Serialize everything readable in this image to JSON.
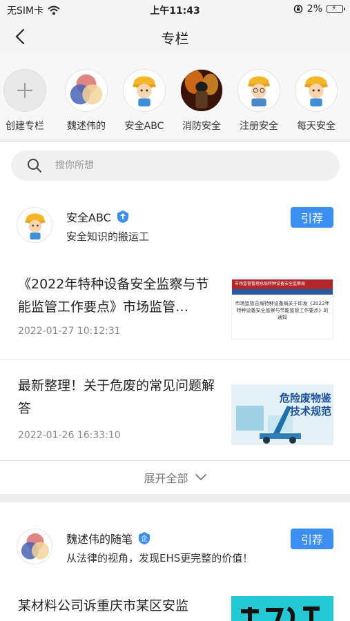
{
  "status_bar": {
    "carrier": "无SIM卡",
    "time": "上午11:43",
    "battery": "2%"
  },
  "nav": {
    "title": "专栏"
  },
  "columns": [
    {
      "label": "创建专栏",
      "icon": "plus-icon"
    },
    {
      "label": "魏述伟的",
      "icon": "venn-avatar"
    },
    {
      "label": "安全ABC",
      "icon": "worker-avatar"
    },
    {
      "label": "消防安全",
      "icon": "firefighter-avatar"
    },
    {
      "label": "注册安全",
      "icon": "worker-glasses-avatar"
    },
    {
      "label": "每天安全",
      "icon": "worker-avatar"
    }
  ],
  "search": {
    "placeholder": "搜你所想"
  },
  "feed": [
    {
      "author": "安全ABC",
      "badge": "verified-arrow",
      "desc": "安全知识的搬运工",
      "subscribe_label": "引荐",
      "articles": [
        {
          "title": "《2022年特种设备安全监察与节能监管工作要点》市场监管…",
          "date": "2022-01-27 10:12:31",
          "thumb": {
            "header": "市场监督管理总局特种设备安全监察局",
            "caption": "市场监管总局特种设备局关于印发《2022年特种设备安全监察与节能监管工作要点》的通知"
          }
        },
        {
          "title": "最新整理！关于危废的常见问题解答",
          "date": "2022-01-26 16:33:10",
          "thumb": {
            "line1": "危险废物鉴",
            "line2": "技术规范"
          }
        }
      ]
    },
    {
      "author": "魏述伟的随笔",
      "badge": "enterprise-企",
      "desc": "从法律的视角，发现EHS更完整的价值！",
      "subscribe_label": "引荐",
      "articles": [
        {
          "title": "某材料公司诉重庆市某区安监"
        }
      ]
    }
  ],
  "expand_label": "展开全部",
  "colors": {
    "accent": "#3b8ff0",
    "badge": "#3b8ff0"
  }
}
